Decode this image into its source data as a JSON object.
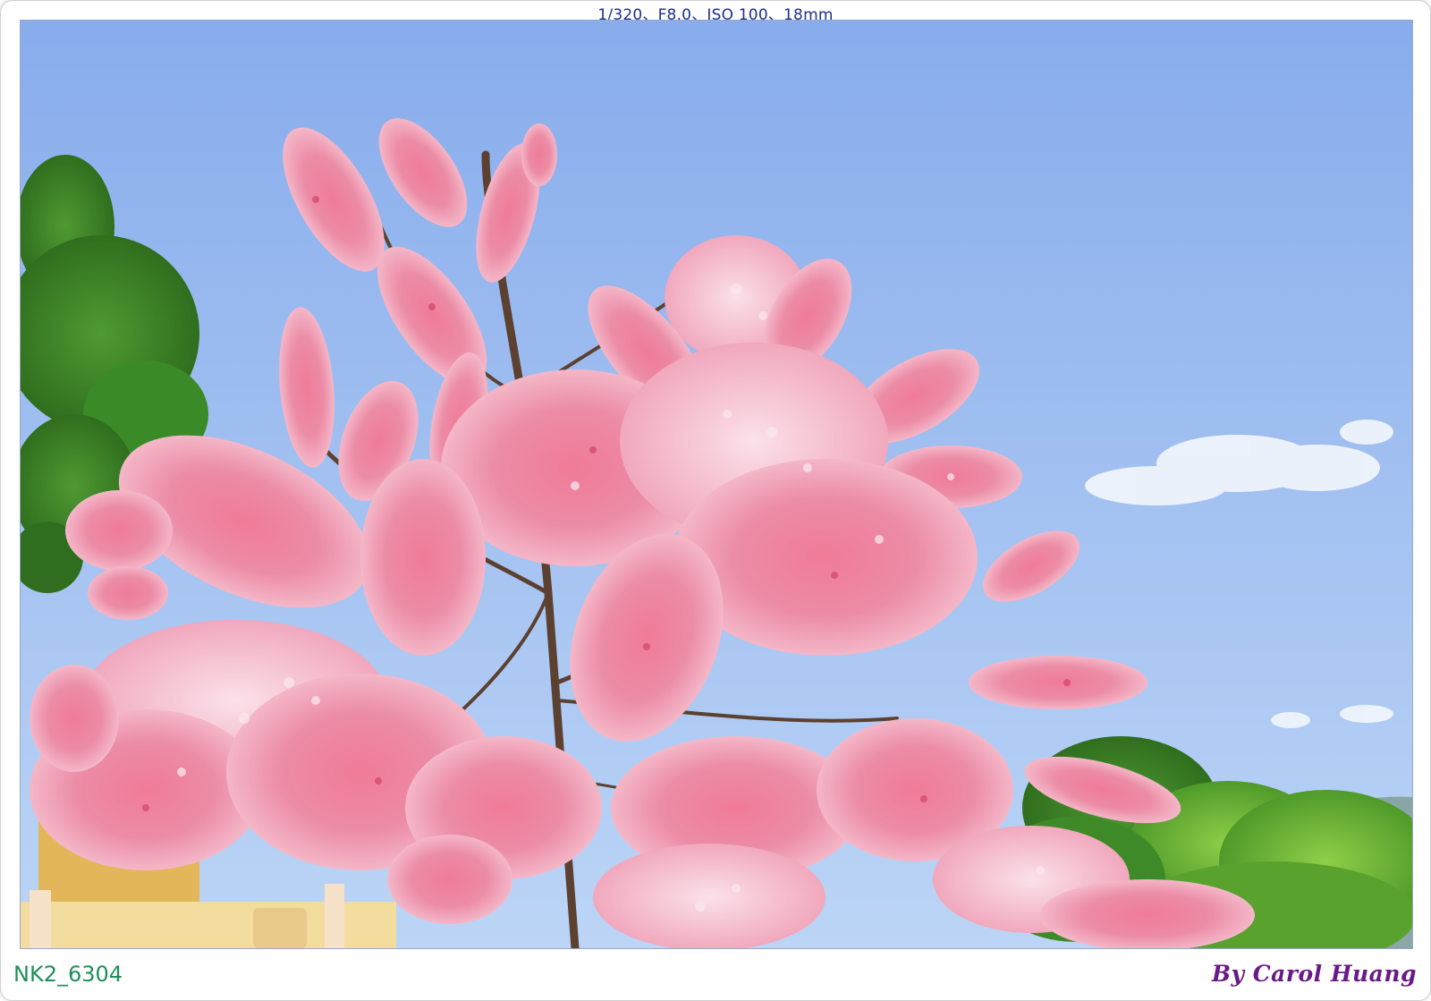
{
  "header": {
    "exif_text": "1/320、F8.0、ISO 100、18mm"
  },
  "footer": {
    "file_id": "NK2_6304",
    "credit": "By Carol Huang"
  },
  "colors": {
    "sky_top": "#8fb2ef",
    "sky_bottom": "#b8d2f5",
    "blossom_pink": "#e8708f",
    "blossom_light": "#f5c4d2",
    "foliage_green": "#3e8a2a",
    "exif_text": "#1d2f8f",
    "file_id_text": "#1f8f5a",
    "credit_text": "#6a1a86"
  }
}
